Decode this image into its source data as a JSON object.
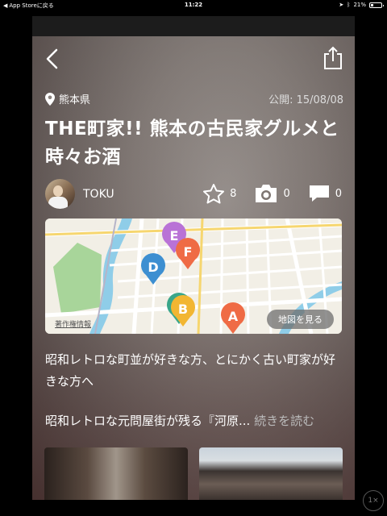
{
  "status_bar": {
    "back_app": "App Storeに戻る",
    "time": "11:22",
    "battery": "21%",
    "battery_level": 0.21
  },
  "article": {
    "location": "熊本県",
    "published": "公開: 15/08/08",
    "title": "THE町家!! 熊本の古民家グルメと時々お酒",
    "author": "TOKU",
    "likes": "8",
    "photos": "0",
    "comments": "0",
    "description": "昭和レトロな町並が好きな方、とにかく古い町家が好きな方へ",
    "excerpt": "昭和レトロな元問屋街が残る『河原...",
    "read_more": "続きを読む"
  },
  "map": {
    "credit": "著作権情報",
    "view_button": "地図を見る",
    "pins": [
      {
        "label": "E",
        "color": "#b972d6"
      },
      {
        "label": "F",
        "color": "#ef6b45"
      },
      {
        "label": "D",
        "color": "#3d8fd1"
      },
      {
        "label": "B",
        "color": "#f2b632"
      },
      {
        "label": "A",
        "color": "#ef6b45"
      }
    ]
  },
  "zoom_label": "1×",
  "icons": {
    "back": "chevron-left-icon",
    "share": "share-icon",
    "location": "location-pin-icon",
    "star": "star-icon",
    "camera": "camera-icon",
    "comment": "comment-icon"
  }
}
